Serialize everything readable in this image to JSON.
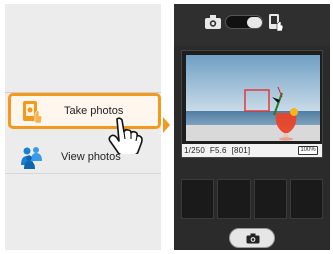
{
  "left_screen": {
    "menu": [
      {
        "label": "Take photos",
        "icon": "take-photos-icon",
        "highlight_color": "#f39a1e"
      },
      {
        "label": "View photos",
        "icon": "view-photos-icon"
      }
    ]
  },
  "right_screen": {
    "status": {
      "shutter_speed": "1/250",
      "aperture": "F5.6",
      "shots_remaining": "[801]",
      "battery": "100%"
    },
    "thumbnails_count_visible": 4,
    "icons": [
      "camera-mode-icon",
      "mode-toggle",
      "remote-icon",
      "shutter-camera-icon"
    ]
  },
  "colors": {
    "accent": "#f39a1e",
    "menu_bg": "#ececec",
    "camera_bg": "#2b2b2b"
  }
}
